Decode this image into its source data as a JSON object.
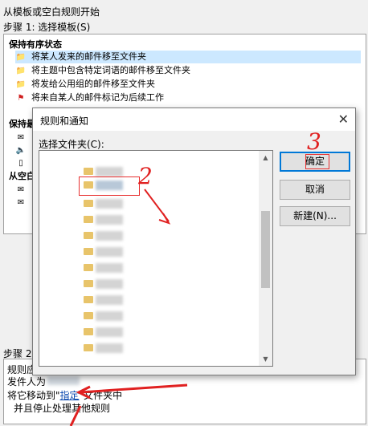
{
  "wizard": {
    "title": "从模板或空白规则开始",
    "step1_label": "步骤 1: 选择模板(S)",
    "step2_label": "步骤 2:"
  },
  "template_list": {
    "groups": [
      {
        "name": "保持有序状态",
        "items": [
          {
            "label": "将某人发来的邮件移至文件夹",
            "icon": "folder-envelope-icon"
          },
          {
            "label": "将主题中包含特定词语的邮件移至文件夹",
            "icon": "folder-envelope-icon"
          },
          {
            "label": "将发给公用组的邮件移至文件夹",
            "icon": "folder-envelope-icon"
          },
          {
            "label": "将来自某人的邮件标记为后续工作",
            "icon": "flag-icon"
          }
        ]
      },
      {
        "name": "保持最"
      },
      {
        "name": "从空白"
      }
    ]
  },
  "rule_description": {
    "line1": "规则应",
    "line2_prefix": "发件人为",
    "line3_prefix": "将它移动到",
    "line3_link": "指定",
    "line3_suffix": "文件夹中",
    "line4": "并且停止处理其他规则"
  },
  "dialog": {
    "title": "规则和通知",
    "close_glyph": "✕",
    "folder_label": "选择文件夹(C):",
    "ok_label": "确定",
    "cancel_label": "取消",
    "new_label": "新建(N)..."
  },
  "annotations": {
    "two": "2",
    "three": "3"
  },
  "colors": {
    "selection": "#cce8ff",
    "annotation": "#e02020",
    "link": "#0645ad",
    "folder": "#e8c46a"
  }
}
